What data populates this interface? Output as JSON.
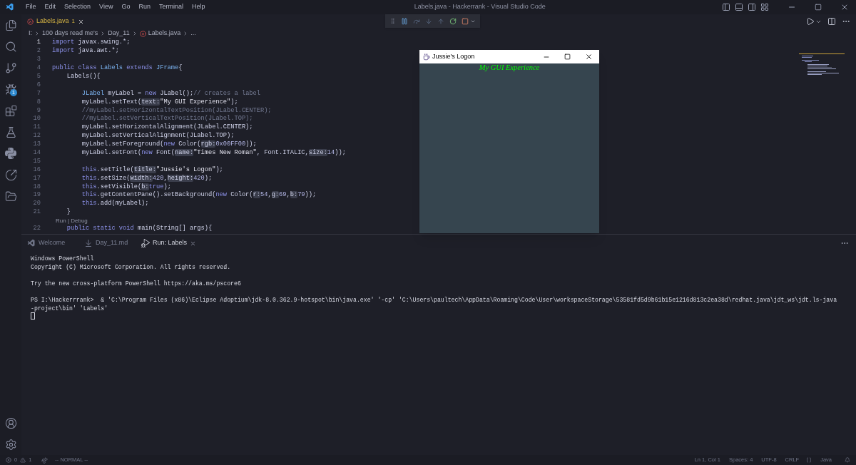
{
  "menu": [
    "File",
    "Edit",
    "Selection",
    "View",
    "Go",
    "Run",
    "Terminal",
    "Help"
  ],
  "window_title": "Labels.java - Hackerrank - Visual Studio Code",
  "activity_badge": "1",
  "editor_tabs": [
    {
      "label": "Labels.java",
      "problems": "1",
      "selected": true
    }
  ],
  "breadcrumbs": [
    "I:",
    "100 days read me's",
    "Day_11",
    "Labels.java",
    "..."
  ],
  "code_lines": [
    {
      "number": "1",
      "current": true,
      "tokens": [
        {
          "kind": "kw",
          "text": "import "
        },
        {
          "kind": "txt",
          "text": "javax.swing.*;"
        }
      ]
    },
    {
      "number": "2",
      "current": false,
      "tokens": [
        {
          "kind": "kw",
          "text": "import "
        },
        {
          "kind": "txt",
          "text": "java.awt.*;"
        }
      ]
    },
    {
      "number": "3",
      "current": false
    },
    {
      "number": "4",
      "current": false,
      "tokens": [
        {
          "kind": "kw",
          "text": "public class "
        },
        {
          "kind": "cls",
          "text": "Labels"
        },
        {
          "kind": "kw",
          "text": " extends "
        },
        {
          "kind": "cls",
          "text": "JFrame"
        },
        {
          "kind": "txt",
          "text": "{"
        }
      ]
    },
    {
      "number": "5",
      "current": false,
      "tokens": [
        {
          "kind": "txt",
          "text": "    Labels(){"
        }
      ]
    },
    {
      "number": "6",
      "current": false
    },
    {
      "number": "7",
      "current": false,
      "tokens": [
        {
          "kind": "cls",
          "text": "        JLabel"
        },
        {
          "kind": "txt",
          "text": " myLabel = "
        },
        {
          "kind": "kw",
          "text": "new "
        },
        {
          "kind": "txt",
          "text": "JLabel();"
        },
        {
          "kind": "cmt",
          "text": "// creates a label"
        }
      ]
    },
    {
      "number": "8",
      "current": false,
      "tokens": [
        {
          "kind": "txt",
          "text": "        myLabel.setText("
        },
        {
          "kind": "hint",
          "text": "text:"
        },
        {
          "kind": "str",
          "text": "\"My GUI Experience\""
        },
        {
          "kind": "txt",
          "text": ");"
        }
      ]
    },
    {
      "number": "9",
      "current": false,
      "tokens": [
        {
          "kind": "cmt",
          "text": "        //myLabel.setHorizontalTextPosition(JLabel.CENTER);"
        }
      ]
    },
    {
      "number": "10",
      "current": false,
      "tokens": [
        {
          "kind": "cmt",
          "text": "        //myLabel.setVerticalTextPosition(JLabel.TOP);"
        }
      ]
    },
    {
      "number": "11",
      "current": false,
      "tokens": [
        {
          "kind": "txt",
          "text": "        myLabel.setHorizontalAlignment(JLabel.CENTER);"
        }
      ]
    },
    {
      "number": "12",
      "current": false,
      "tokens": [
        {
          "kind": "txt",
          "text": "        myLabel.setVerticalAlignment(JLabel.TOP);"
        }
      ]
    },
    {
      "number": "13",
      "current": false,
      "tokens": [
        {
          "kind": "txt",
          "text": "        myLabel.setForeground("
        },
        {
          "kind": "kw",
          "text": "new "
        },
        {
          "kind": "txt",
          "text": "Color("
        },
        {
          "kind": "hint",
          "text": "rgb:"
        },
        {
          "kind": "num",
          "text": "0x00FF00"
        },
        {
          "kind": "txt",
          "text": "));"
        }
      ]
    },
    {
      "number": "14",
      "current": false,
      "tokens": [
        {
          "kind": "txt",
          "text": "        myLabel.setFont("
        },
        {
          "kind": "kw",
          "text": "new "
        },
        {
          "kind": "txt",
          "text": "Font("
        },
        {
          "kind": "hint",
          "text": "name:"
        },
        {
          "kind": "str",
          "text": "\"Times New Roman\""
        },
        {
          "kind": "txt",
          "text": ", Font.ITALIC,"
        },
        {
          "kind": "hint",
          "text": "size:"
        },
        {
          "kind": "num",
          "text": "14"
        },
        {
          "kind": "txt",
          "text": "));"
        }
      ]
    },
    {
      "number": "15",
      "current": false
    },
    {
      "number": "16",
      "current": false,
      "tokens": [
        {
          "kind": "kw",
          "text": "        this"
        },
        {
          "kind": "txt",
          "text": ".setTitle("
        },
        {
          "kind": "hint",
          "text": "title:"
        },
        {
          "kind": "str",
          "text": "\"Jussie's Logon\""
        },
        {
          "kind": "txt",
          "text": ");"
        }
      ]
    },
    {
      "number": "17",
      "current": false,
      "tokens": [
        {
          "kind": "kw",
          "text": "        this"
        },
        {
          "kind": "txt",
          "text": ".setSize("
        },
        {
          "kind": "hint",
          "text": "width:"
        },
        {
          "kind": "num",
          "text": "420"
        },
        {
          "kind": "txt",
          "text": ","
        },
        {
          "kind": "hint",
          "text": "height:"
        },
        {
          "kind": "num",
          "text": "420"
        },
        {
          "kind": "txt",
          "text": ");"
        }
      ]
    },
    {
      "number": "18",
      "current": false,
      "tokens": [
        {
          "kind": "kw",
          "text": "        this"
        },
        {
          "kind": "txt",
          "text": ".setVisible("
        },
        {
          "kind": "hint",
          "text": "b:"
        },
        {
          "kind": "kw",
          "text": "true"
        },
        {
          "kind": "txt",
          "text": ");"
        }
      ]
    },
    {
      "number": "19",
      "current": false,
      "tokens": [
        {
          "kind": "kw",
          "text": "        this"
        },
        {
          "kind": "txt",
          "text": ".getContentPane().setBackground("
        },
        {
          "kind": "kw",
          "text": "new "
        },
        {
          "kind": "txt",
          "text": "Color("
        },
        {
          "kind": "hint",
          "text": "r:"
        },
        {
          "kind": "num",
          "text": "54"
        },
        {
          "kind": "txt",
          "text": ","
        },
        {
          "kind": "hint",
          "text": "g:"
        },
        {
          "kind": "num",
          "text": "69"
        },
        {
          "kind": "txt",
          "text": ","
        },
        {
          "kind": "hint",
          "text": "b:"
        },
        {
          "kind": "num",
          "text": "79"
        },
        {
          "kind": "txt",
          "text": "));"
        }
      ]
    },
    {
      "number": "20",
      "current": false,
      "tokens": [
        {
          "kind": "kw",
          "text": "        this"
        },
        {
          "kind": "txt",
          "text": ".add(myLabel);"
        }
      ]
    },
    {
      "number": "21",
      "current": false,
      "tokens": [
        {
          "kind": "txt",
          "text": "    }"
        }
      ]
    },
    {
      "codelens": "Run | Debug"
    },
    {
      "number": "22",
      "current": false,
      "tokens": [
        {
          "kind": "kw",
          "text": "    public static void "
        },
        {
          "kind": "txt",
          "text": "main(String[] args){"
        }
      ]
    }
  ],
  "java_window": {
    "title": "Jussie's Logon",
    "label": "My GUI Experience"
  },
  "panel_tabs": [
    {
      "label": "Welcome",
      "selected": false
    },
    {
      "label": "Day_11.md",
      "selected": false
    },
    {
      "label": "Run: Labels",
      "selected": true
    }
  ],
  "terminal_blocks": [
    [
      "Windows PowerShell",
      "Copyright (C) Microsoft Corporation. All rights reserved."
    ],
    [
      "Try the new cross-platform PowerShell https://aka.ms/pscore6"
    ],
    [
      "PS I:\\Hackerrrank>  & 'C:\\Program Files (x86)\\Eclipse Adoptium\\jdk-8.0.362.9-hotspot\\bin\\java.exe' '-cp' 'C:\\Users\\paultech\\AppData\\Roaming\\Code\\User\\workspaceStorage\\53581fd5d9b61b15e1216d813c2ea38d\\redhat.java\\jdt_ws\\jdt.ls-java",
      "-project\\bin' 'Labels'"
    ]
  ],
  "status_bar": {
    "errors": "0",
    "warnings": "1",
    "mode": "-- NORMAL --",
    "right": [
      "Ln 1, Col 1",
      "Spaces: 4",
      "UTF-8",
      "CRLF",
      "Java"
    ]
  }
}
